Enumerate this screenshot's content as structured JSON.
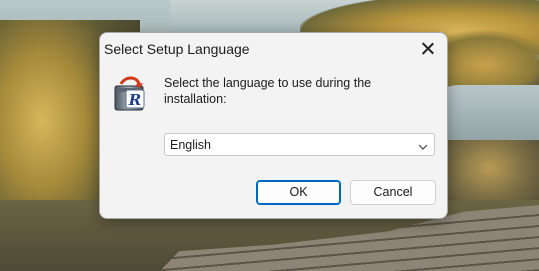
{
  "dialog": {
    "title": "Select Setup Language",
    "prompt": "Select the language to use during the installation:",
    "language_select": {
      "selected": "English"
    },
    "ok_label": "OK",
    "cancel_label": "Cancel"
  },
  "icons": {
    "close": "close-icon",
    "setup": "setup-installer-icon",
    "dropdown": "chevron-down-icon"
  },
  "colors": {
    "dialog_bg": "#f3f3f3",
    "accent": "#0067c0"
  }
}
